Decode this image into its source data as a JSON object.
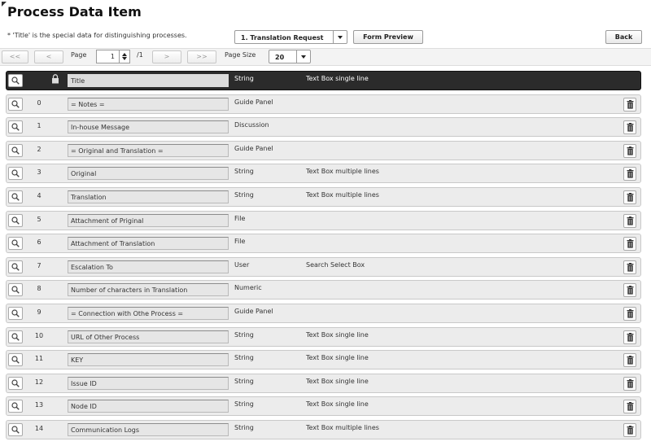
{
  "header": {
    "title": "Process Data Item",
    "note": "* 'Title' is the special data for distinguishing processes.",
    "process_select": "1. Translation Request",
    "form_preview_label": "Form Preview",
    "back_label": "Back"
  },
  "pager": {
    "first_label": "<<",
    "prev_label": "<",
    "page_label": "Page",
    "page_value": "1",
    "page_total": "/1",
    "next_label": ">",
    "last_label": ">>",
    "page_size_label": "Page Size",
    "page_size_value": "20"
  },
  "title_row": {
    "name": "Title",
    "type": "String",
    "control": "Text Box single line"
  },
  "items": [
    {
      "index": "0",
      "name": "= Notes =",
      "type": "Guide Panel",
      "control": ""
    },
    {
      "index": "1",
      "name": "In-house Message",
      "type": "Discussion",
      "control": ""
    },
    {
      "index": "2",
      "name": "= Original and Translation =",
      "type": "Guide Panel",
      "control": ""
    },
    {
      "index": "3",
      "name": "Original",
      "type": "String",
      "control": "Text Box multiple lines"
    },
    {
      "index": "4",
      "name": "Translation",
      "type": "String",
      "control": "Text Box multiple lines"
    },
    {
      "index": "5",
      "name": "Attachment of Priginal",
      "type": "File",
      "control": ""
    },
    {
      "index": "6",
      "name": "Attachment of Translation",
      "type": "File",
      "control": ""
    },
    {
      "index": "7",
      "name": "Escalation  To",
      "type": "User",
      "control": "Search Select Box"
    },
    {
      "index": "8",
      "name": "Number of characters in Translation",
      "type": "Numeric",
      "control": ""
    },
    {
      "index": "9",
      "name": "= Connection with Othe Process =",
      "type": "Guide Panel",
      "control": ""
    },
    {
      "index": "10",
      "name": "URL of Other Process",
      "type": "String",
      "control": "Text Box single line"
    },
    {
      "index": "11",
      "name": "KEY",
      "type": "String",
      "control": "Text Box single line"
    },
    {
      "index": "12",
      "name": "Issue ID",
      "type": "String",
      "control": "Text Box single line"
    },
    {
      "index": "13",
      "name": "Node ID",
      "type": "String",
      "control": "Text Box single line"
    },
    {
      "index": "14",
      "name": "Communication Logs",
      "type": "String",
      "control": "Text Box multiple lines"
    }
  ],
  "icons": {
    "detail": "magnifier-icon",
    "delete": "trash-icon",
    "lock": "lock-icon"
  }
}
